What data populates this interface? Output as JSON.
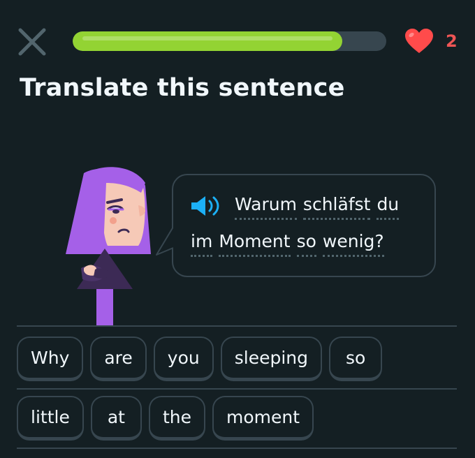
{
  "header": {
    "close_icon": "close-icon",
    "progress_fraction": 0.86,
    "progress_color": "#93d333",
    "hearts_icon": "heart-icon",
    "hearts_count": "2",
    "hearts_color": "#ff4b4b"
  },
  "title": "Translate this sentence",
  "prompt": {
    "speaker_icon": "speaker-icon",
    "line1": [
      "Warum",
      "schläfst",
      "du"
    ],
    "line2": [
      "im",
      "Moment",
      "so",
      "wenig?"
    ]
  },
  "word_bank": {
    "row1": [
      "Why",
      "are",
      "you",
      "sleeping",
      "so"
    ],
    "row2": [
      "little",
      "at",
      "the",
      "moment"
    ]
  },
  "colors": {
    "background": "#141f23",
    "border": "#37464f",
    "accent_blue": "#1cb0f6",
    "character_hair": "#a560e8"
  }
}
